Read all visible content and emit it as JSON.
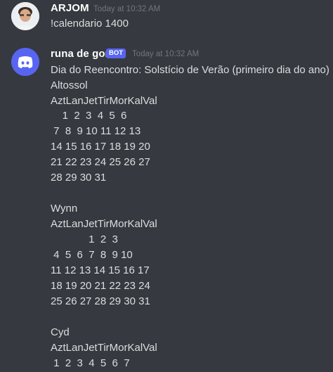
{
  "messages": [
    {
      "username": "ARJOM",
      "timestamp": "Today at 10:32 AM",
      "text": "!calendario 1400"
    },
    {
      "username": "runa de gor",
      "tag": "BOT",
      "timestamp": "Today at 10:32 AM",
      "lines": [
        "Dia do Reencontro: Solstício de Verão (primeiro dia do ano)",
        "Altossol",
        "AztLanJetTirMorKalVal",
        "    1  2  3  4  5  6",
        " 7  8  9 10 11 12 13",
        "14 15 16 17 18 19 20",
        "21 22 23 24 25 26 27",
        "28 29 30 31",
        "",
        "Wynn",
        "AztLanJetTirMorKalVal",
        "             1  2  3",
        " 4  5  6  7  8  9 10",
        "11 12 13 14 15 16 17",
        "18 19 20 21 22 23 24",
        "25 26 27 28 29 30 31",
        "",
        "Cyd",
        "AztLanJetTirMorKalVal",
        " 1  2  3  4  5  6  7"
      ]
    }
  ]
}
